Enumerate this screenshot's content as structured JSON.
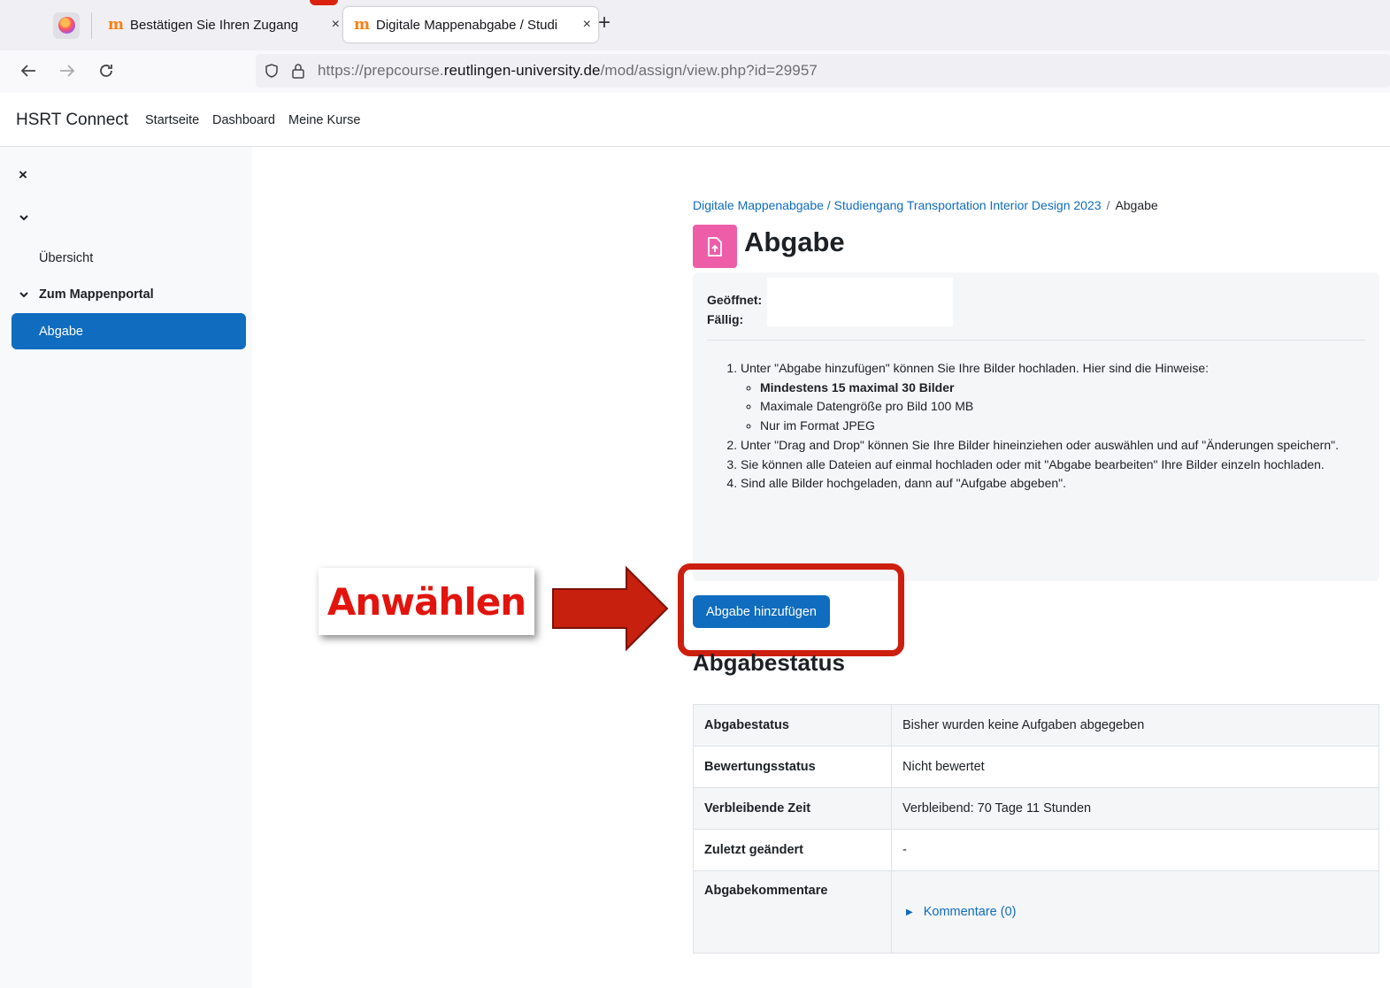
{
  "browser": {
    "tabs": [
      {
        "label": "Bestätigen Sie Ihren Zugang",
        "close": "×"
      },
      {
        "label": "Digitale Mappenabgabe / Studi",
        "close": "×"
      }
    ],
    "new_tab": "+",
    "url": {
      "prefix": "https://prepcourse.",
      "domain": "reutlingen-university.de",
      "path": "/mod/assign/view.php?id=29957"
    }
  },
  "site": {
    "brand": "HSRT Connect",
    "nav": [
      "Startseite",
      "Dashboard",
      "Meine Kurse"
    ]
  },
  "drawer": {
    "close": "×",
    "overview": "Übersicht",
    "section": "Zum Mappenportal",
    "active_item": "Abgabe"
  },
  "main": {
    "breadcrumb": {
      "link": "Digitale Mappenabgabe / Studiengang Transportation Interior Design 2023",
      "separator": "/",
      "current": "Abgabe"
    },
    "title": "Abgabe",
    "dates": {
      "opened_label": "Geöffnet:",
      "due_label": "Fällig:"
    },
    "instructions": {
      "step1": "Unter \"Abgabe hinzufügen\" können Sie Ihre Bilder hochladen. Hier sind die Hinweise:",
      "bullet1": "Mindestens 15 maximal 30 Bilder",
      "bullet2": "Maximale Datengröße pro Bild 100 MB",
      "bullet3": "Nur im Format JPEG",
      "step2": "Unter \"Drag and Drop\" können Sie Ihre Bilder hineinziehen oder auswählen und auf \"Änderungen speichern\".",
      "step3": "Sie können alle Dateien auf einmal hochladen oder mit \"Abgabe bearbeiten\" Ihre Bilder einzeln hochladen.",
      "step4": "Sind alle Bilder hochgeladen, dann auf \"Aufgabe abgeben\"."
    },
    "add_button": "Abgabe hinzufügen",
    "status_title": "Abgabestatus",
    "status_rows": [
      {
        "label": "Abgabestatus",
        "value": "Bisher wurden keine Aufgaben abgegeben"
      },
      {
        "label": "Bewertungsstatus",
        "value": "Nicht bewertet"
      },
      {
        "label": "Verbleibende Zeit",
        "value": "Verbleibend: 70 Tage 11 Stunden"
      },
      {
        "label": "Zuletzt geändert",
        "value": "-"
      },
      {
        "label": "Abgabekommentare",
        "value": "Kommentare (0)"
      }
    ]
  },
  "annotation": {
    "label": "Anwählen",
    "color": "#e2140d",
    "frame_color": "#cd1f0d"
  },
  "colors": {
    "primary": "#0f6cbf",
    "activity_icon": "#ee5ea8",
    "moodle_orange": "#f98012"
  }
}
